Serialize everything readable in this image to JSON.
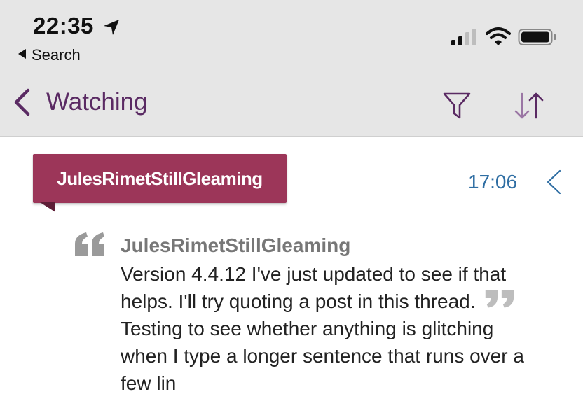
{
  "status_bar": {
    "time": "22:35",
    "back_app_label": "Search"
  },
  "nav": {
    "title": "Watching"
  },
  "post": {
    "author_banner": "JulesRimetStillGleaming",
    "time": "17:06",
    "quote_author": "JulesRimetStillGleaming",
    "quote_text_before": "Version 4.4.12 I've just updated to see if that helps. I'll try quoting a post in this thread.",
    "quote_text_after": "Testing to see whether anything is glitching when I type a longer sentence that runs over a few lin"
  },
  "colors": {
    "accent": "#5a2a63",
    "banner": "#9c3659",
    "link": "#2f6ea3"
  },
  "icons": [
    "location-arrow-icon",
    "signal-icon",
    "wifi-icon",
    "battery-icon",
    "back-chevron-icon",
    "filter-icon",
    "sort-icon",
    "chevron-left-icon",
    "quote-icon"
  ]
}
